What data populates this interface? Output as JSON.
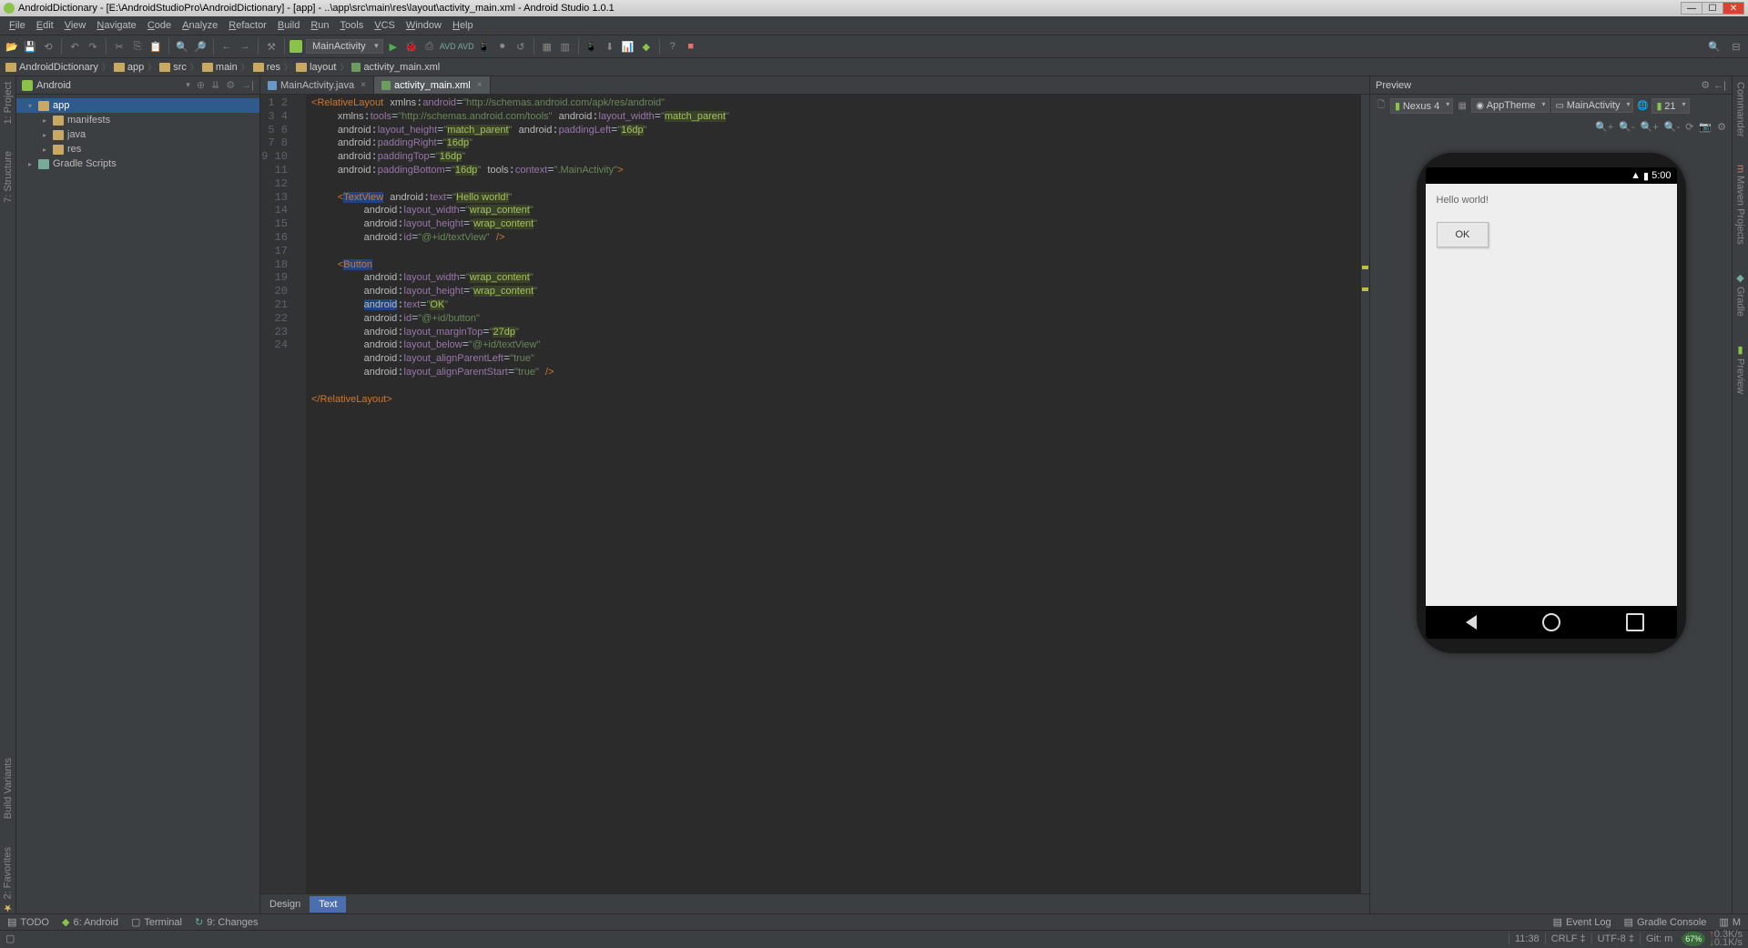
{
  "titlebar": {
    "text": "AndroidDictionary - [E:\\AndroidStudioPro\\AndroidDictionary] - [app] - ..\\app\\src\\main\\res\\layout\\activity_main.xml - Android Studio 1.0.1"
  },
  "menubar": [
    "File",
    "Edit",
    "View",
    "Navigate",
    "Code",
    "Analyze",
    "Refactor",
    "Build",
    "Run",
    "Tools",
    "VCS",
    "Window",
    "Help"
  ],
  "toolbar": {
    "config": "MainActivity",
    "avd_text1": "AVD",
    "avd_text2": "AVD"
  },
  "breadcrumb": [
    "AndroidDictionary",
    "app",
    "src",
    "main",
    "res",
    "layout",
    "activity_main.xml"
  ],
  "project_header": {
    "title": "Android"
  },
  "tree": [
    {
      "label": "app",
      "selected": true,
      "arrow": "▾",
      "icon": "module"
    },
    {
      "label": "manifests",
      "indent": 1,
      "arrow": "▸",
      "icon": "folder"
    },
    {
      "label": "java",
      "indent": 1,
      "arrow": "▸",
      "icon": "folder"
    },
    {
      "label": "res",
      "indent": 1,
      "arrow": "▸",
      "icon": "folder"
    },
    {
      "label": "Gradle Scripts",
      "arrow": "▸",
      "icon": "gradle"
    }
  ],
  "tabs": [
    {
      "label": "MainActivity.java",
      "active": false,
      "icon": "#6a98c4"
    },
    {
      "label": "activity_main.xml",
      "active": true,
      "icon": "#6d9c5f"
    }
  ],
  "line_numbers": [
    "1",
    "2",
    "3",
    "4",
    "5",
    "6",
    "7",
    "8",
    "9",
    "10",
    "11",
    "12",
    "13",
    "14",
    "15",
    "16",
    "17",
    "18",
    "19",
    "20",
    "21",
    "22",
    "23",
    "24"
  ],
  "code_strings": {
    "rel_open": "RelativeLayout",
    "xmlns_android_attr": "xmlns:android",
    "xmlns_android_val": "http://schemas.android.com/apk/res/android",
    "xmlns_tools_attr": "xmlns:tools",
    "xmlns_tools_val": "http://schemas.android.com/tools",
    "layout_width": "layout_width",
    "match_parent": "match_parent",
    "layout_height": "layout_height",
    "paddingLeft": "paddingLeft",
    "paddingRight": "paddingRight",
    "paddingTop": "paddingTop",
    "paddingBottom": "paddingBottom",
    "dp16": "16dp",
    "tools_ns": "tools",
    "android_ns": "android",
    "context_attr": "context",
    "context_val": ".MainActivity",
    "textview": "TextView",
    "button": "Button",
    "text_attr": "text",
    "hello_val": "Hello world!",
    "ok_val": "OK",
    "wrap_content": "wrap_content",
    "id_attr": "id",
    "tv_id": "@+id/textView",
    "btn_id": "@+id/button",
    "marginTop": "layout_marginTop",
    "dp27": "27dp",
    "below": "layout_below",
    "below_val": "@+id/textView",
    "alignLeft": "layout_alignParentLeft",
    "alignStart": "layout_alignParentStart",
    "true_val": "true",
    "close_rel": "RelativeLayout"
  },
  "editor_bottom_tabs": {
    "design": "Design",
    "text": "Text"
  },
  "preview": {
    "title": "Preview",
    "device": "Nexus 4",
    "theme": "AppTheme",
    "activity": "MainActivity",
    "api": "21",
    "status_time": "5:00",
    "hello_text": "Hello world!",
    "ok_label": "OK"
  },
  "left_tools": [
    "1: Project",
    "7: Structure"
  ],
  "left_tools_bottom": [
    "Build Variants",
    "2: Favorites"
  ],
  "right_tools": [
    "Commander",
    "Maven Projects",
    "Gradle",
    "Preview"
  ],
  "bottom_tools": {
    "todo": "TODO",
    "android": "6: Android",
    "terminal": "Terminal",
    "changes": "9: Changes",
    "eventlog": "Event Log",
    "gradle": "Gradle Console",
    "m": "M"
  },
  "status": {
    "pos": "11:38",
    "crlf": "CRLF",
    "enc": "UTF-8",
    "git": "Git: m",
    "mem": "67%",
    "up": "0.3K/s",
    "down": "0.1K/s"
  }
}
